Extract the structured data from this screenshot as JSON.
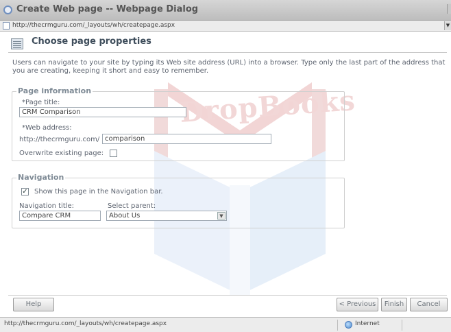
{
  "window": {
    "title": "Create Web page -- Webpage Dialog",
    "address": "http://thecrmguru.com/_layouts/wh/createpage.aspx"
  },
  "header": {
    "title": "Choose page properties",
    "icon": "page-properties-icon"
  },
  "intro": "Users can navigate to your site by typing its Web site address (URL) into a browser. Type only the last part of the address that you are creating, keeping it short and easy to remember.",
  "watermark": "DropBooks",
  "page_information": {
    "legend": "Page information",
    "page_title_label": "*Page title:",
    "page_title_value": "CRM Comparison",
    "web_address_label": "*Web address:",
    "url_prefix": "http://thecrmguru.com/",
    "web_address_value": "comparison",
    "overwrite_label": "Overwrite existing page:",
    "overwrite_checked": false
  },
  "navigation": {
    "legend": "Navigation",
    "show_label": "Show this page in the Navigation bar.",
    "show_checked": true,
    "nav_title_label": "Navigation title:",
    "nav_title_value": "Compare CRM",
    "select_parent_label": "Select parent:",
    "select_parent_value": "About Us"
  },
  "buttons": {
    "help": "Help",
    "previous": "< Previous",
    "finish": "Finish",
    "cancel": "Cancel"
  },
  "status": {
    "url": "http://thecrmguru.com/_layouts/wh/createpage.aspx",
    "zone": "Internet"
  },
  "colors": {
    "legend": "#7e8a95",
    "watermark": "#d9a3a3",
    "text": "#5d6470"
  }
}
